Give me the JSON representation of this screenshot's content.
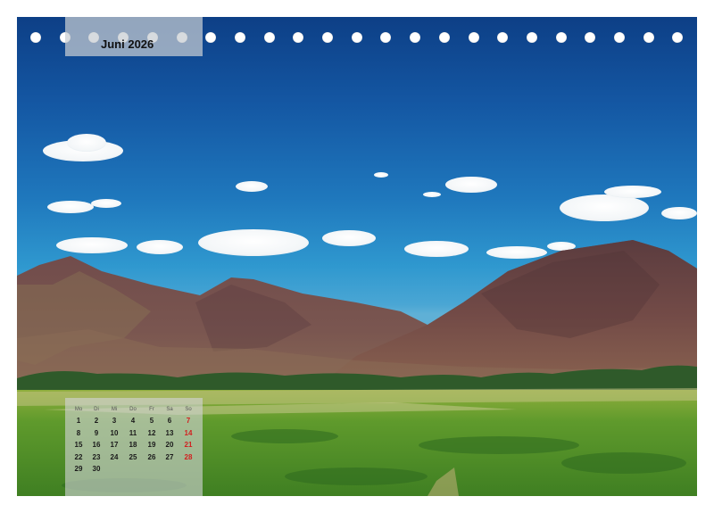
{
  "calendar": {
    "month_label": "Juni 2026",
    "weekday_headers": [
      "Mo",
      "Di",
      "Mi",
      "Do",
      "Fr",
      "Sa",
      "So"
    ],
    "weeks": [
      [
        "1",
        "2",
        "3",
        "4",
        "5",
        "6",
        "7"
      ],
      [
        "8",
        "9",
        "10",
        "11",
        "12",
        "13",
        "14"
      ],
      [
        "15",
        "16",
        "17",
        "18",
        "19",
        "20",
        "21"
      ],
      [
        "22",
        "23",
        "24",
        "25",
        "26",
        "27",
        "28"
      ],
      [
        "29",
        "30",
        "",
        "",
        "",
        "",
        ""
      ]
    ],
    "colors": {
      "weekday": "#1a1a1a",
      "sunday": "#d21f1f"
    }
  },
  "binding": {
    "hole_count": 23
  },
  "photo": {
    "subject": "mountain-landscape-photo"
  }
}
